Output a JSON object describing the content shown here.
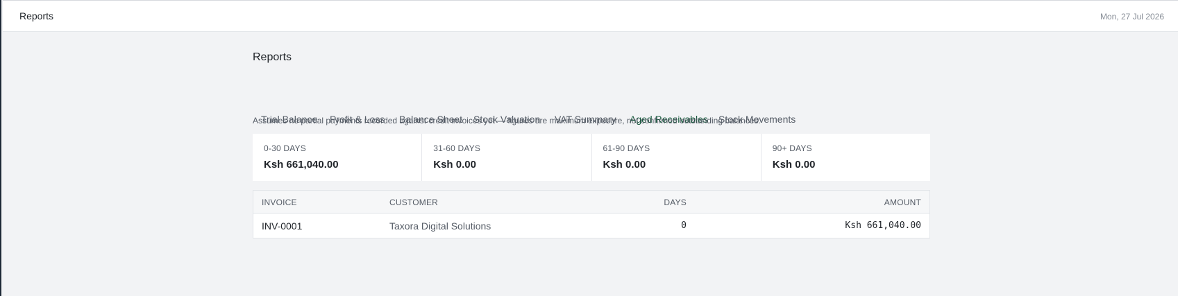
{
  "header": {
    "title": "Reports",
    "date": "Mon, 27 Jul 2026"
  },
  "page": {
    "title": "Reports",
    "tabs": [
      {
        "label": "Trial Balance",
        "active": false
      },
      {
        "label": "Profit & Loss",
        "active": false
      },
      {
        "label": "Balance Sheet",
        "active": false
      },
      {
        "label": "Stock Valuation",
        "active": false
      },
      {
        "label": "VAT Summary",
        "active": false
      },
      {
        "label": "Aged Receivables",
        "active": true
      },
      {
        "label": "Stock Movements",
        "active": false
      }
    ],
    "note": "Assumes no partial payments recorded against credit invoices yet — figures are maximum exposure, not confirmed outstanding balances."
  },
  "buckets": [
    {
      "label": "0-30 DAYS",
      "value": "Ksh 661,040.00"
    },
    {
      "label": "31-60 DAYS",
      "value": "Ksh 0.00"
    },
    {
      "label": "61-90 DAYS",
      "value": "Ksh 0.00"
    },
    {
      "label": "90+ DAYS",
      "value": "Ksh 0.00"
    }
  ],
  "table": {
    "columns": [
      "INVOICE",
      "CUSTOMER",
      "DAYS",
      "AMOUNT"
    ],
    "rows": [
      {
        "invoice": "INV-0001",
        "customer": "Taxora Digital Solutions",
        "days": "0",
        "amount": "Ksh 661,040.00"
      }
    ]
  },
  "colors": {
    "accent": "#14573a",
    "sidebar_edge": "#1f2a37",
    "background": "#f2f3f5"
  }
}
